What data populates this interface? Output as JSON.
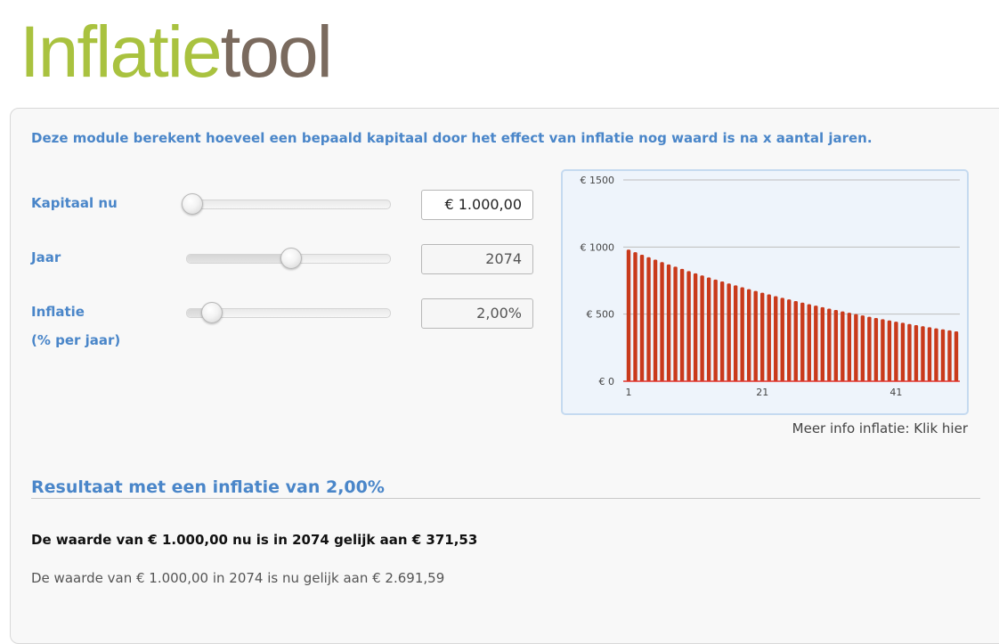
{
  "header": {
    "logo_part_a": "Inflatie",
    "logo_part_b": "tool",
    "colors": {
      "logo_part_a": "#a9c23f",
      "logo_part_b": "#7a6a5e"
    }
  },
  "intro": "Deze module berekent hoeveel een bepaald kapitaal door het effect van inflatie nog waard is na x aantal jaren.",
  "form": {
    "kapitaal": {
      "label": "Kapitaal nu",
      "value": "€ 1.000,00",
      "slider_fraction": 0.02
    },
    "jaar": {
      "label": "Jaar",
      "value": "2074",
      "slider_fraction": 0.51
    },
    "inflatie": {
      "label": "Inflatie",
      "sublabel": "(% per jaar)",
      "value": "2,00%",
      "slider_fraction": 0.12
    }
  },
  "chart_data": {
    "type": "bar",
    "x_start": 1,
    "x_end": 50,
    "start_value": 1000,
    "annual_rate": 0.02,
    "values": [
      980.39,
      961.17,
      942.32,
      923.85,
      905.73,
      887.97,
      870.56,
      853.49,
      836.76,
      820.35,
      804.26,
      788.49,
      773.03,
      757.88,
      743.01,
      728.45,
      714.16,
      700.16,
      686.43,
      672.97,
      659.78,
      646.84,
      634.16,
      621.72,
      609.53,
      597.58,
      585.86,
      574.37,
      563.11,
      552.07,
      541.25,
      530.63,
      520.23,
      510.03,
      500.03,
      490.22,
      480.61,
      471.19,
      461.95,
      452.89,
      444.01,
      435.3,
      426.77,
      418.4,
      410.2,
      402.15,
      394.27,
      386.54,
      378.96,
      371.53
    ],
    "x_tick_labels": [
      "1",
      "21",
      "41"
    ],
    "y_tick_labels": [
      "€ 0",
      "€ 500",
      "€ 1000",
      "€ 1500"
    ],
    "ylim": [
      0,
      1500
    ],
    "grid": true,
    "bar_color": "#c93a1b",
    "background": "#eef4fb"
  },
  "more_info": "Meer info inflatie: Klik hier",
  "result": {
    "title": "Resultaat met een inflatie van 2,00%",
    "main": "De waarde van € 1.000,00 nu is in 2074 gelijk aan € 371,53",
    "sub": "De waarde van € 1.000,00 in 2074 is nu gelijk aan € 2.691,59"
  }
}
